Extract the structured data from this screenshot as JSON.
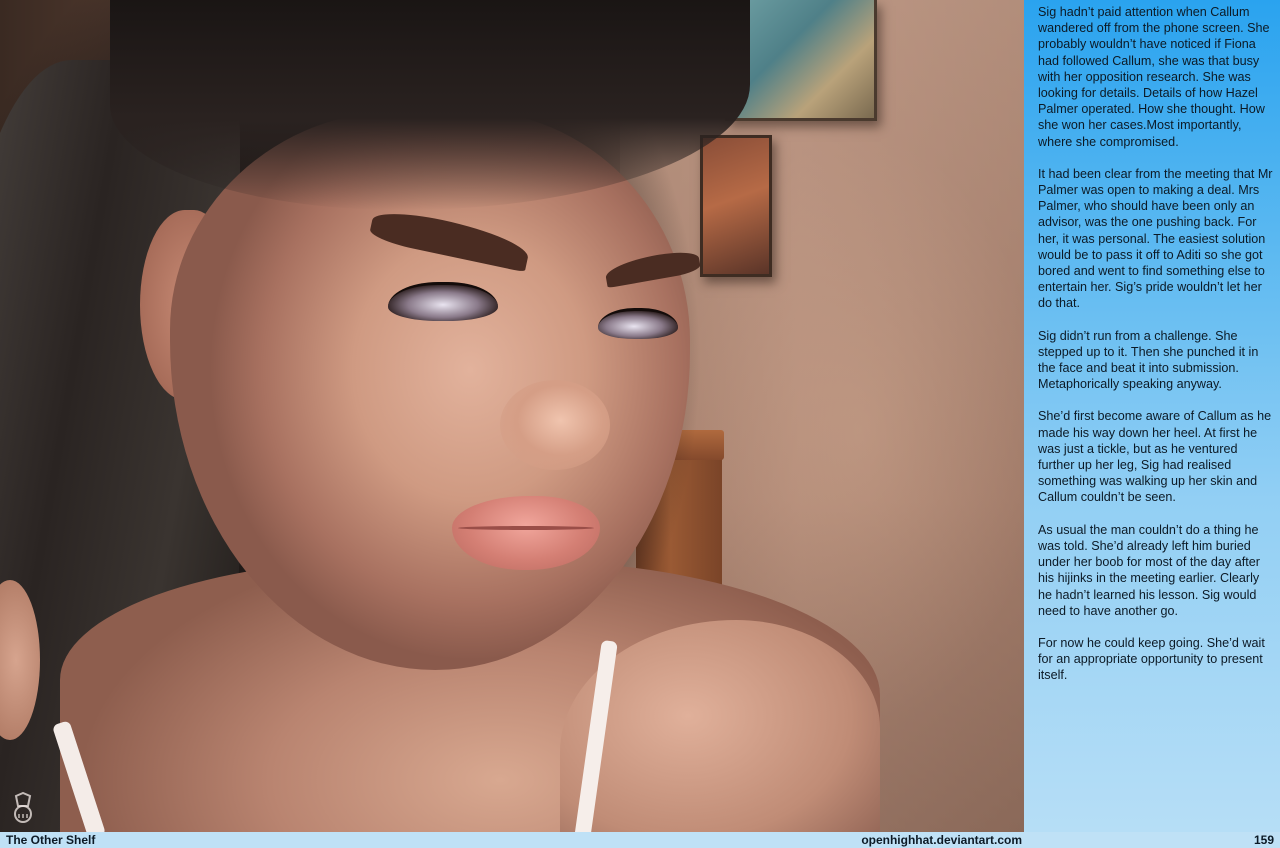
{
  "footer": {
    "title": "The Other Shelf",
    "site": "openhighhat.deviantart.com",
    "page_number": "159"
  },
  "story": {
    "paragraphs": [
      "Sig hadn’t paid attention when Callum wandered off from the phone screen. She probably wouldn’t have noticed if Fiona had followed Callum, she was that busy with her opposition research. She was looking for details. Details of how Hazel Palmer operated. How she thought. How she won her cases.Most importantly, where she compromised.",
      "It had been clear from the meeting that Mr Palmer was open to making a deal. Mrs Palmer, who should have been only an advisor, was the one pushing back. For her, it was personal. The easiest solution would be to pass it off to Aditi so she got bored and went to find something else to entertain her. Sig’s pride wouldn’t let her do that.",
      "Sig didn’t run from a challenge. She stepped up to it. Then she punched it in the face and beat it into submission. Metaphorically speaking anyway.",
      "She’d first become aware of Callum as he made his way down her heel. At first he was just a tickle, but as he ventured further up her leg, Sig had realised something was walking up her skin and Callum couldn’t be seen.",
      "As usual the man couldn’t do a thing he was told. She’d already left him buried under her boob for most of the day after his hijinks in the meeting earlier. Clearly he hadn’t learned his lesson. Sig would need to have another go.",
      "For now he could keep going. She’d wait for an appropriate opportunity to present itself."
    ]
  },
  "colors": {
    "panel_top": "#2aa3ef",
    "panel_bottom": "#b6def6",
    "footer_bg": "#bfe1f6"
  },
  "icons": {
    "logo": "openhighhat-logo-icon"
  }
}
